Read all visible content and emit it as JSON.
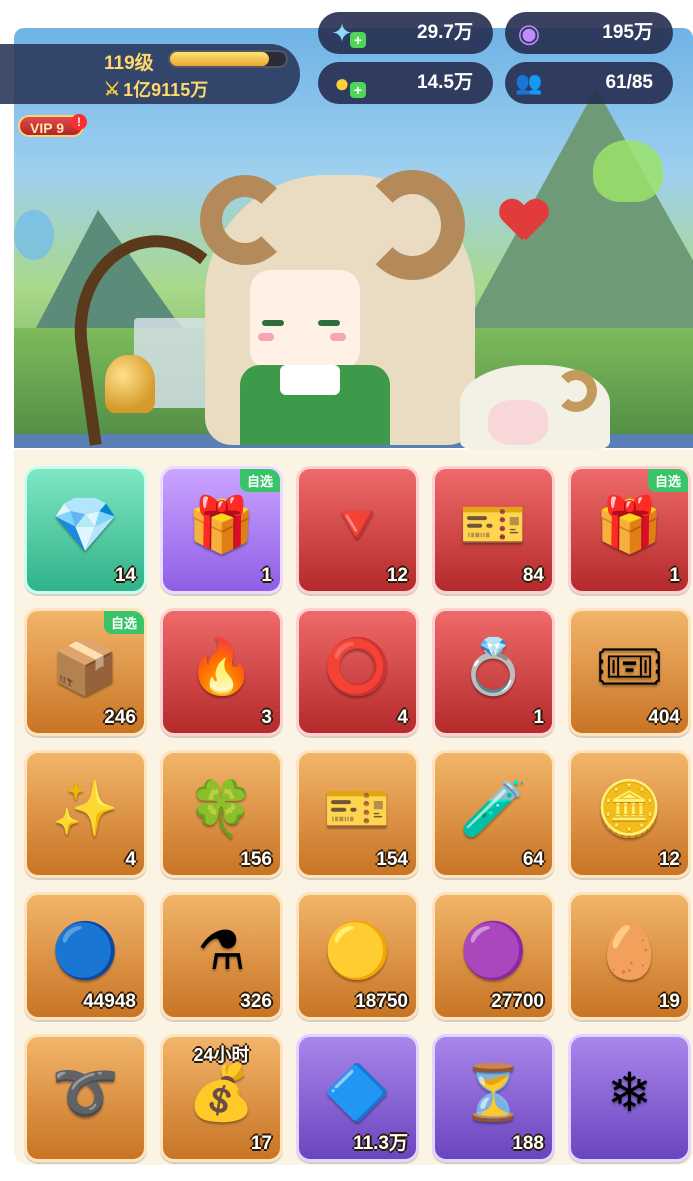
{
  "player": {
    "level": "119级",
    "exp_progress": 0.85,
    "power": "1亿9115万",
    "vip": "VIP 9",
    "vip_alert": "!"
  },
  "currencies": {
    "star": {
      "value": "29.7万",
      "icon": "star-shard-icon"
    },
    "gem": {
      "value": "195万",
      "icon": "purple-gem-icon"
    },
    "coin": {
      "value": "14.5万",
      "icon": "gold-coin-icon"
    },
    "team": {
      "value": "61/85",
      "icon": "team-icon"
    }
  },
  "inventory": [
    {
      "icon": "rainbow-crystal-icon",
      "glyph": "💎",
      "quality": "green",
      "count": "14"
    },
    {
      "icon": "gift-box-selectable-icon",
      "glyph": "🎁",
      "quality": "purple",
      "count": "1",
      "tag": "自选"
    },
    {
      "icon": "red-crystal-icon",
      "glyph": "🔻",
      "quality": "red",
      "count": "12"
    },
    {
      "icon": "gold-ticket-icon",
      "glyph": "🎫",
      "quality": "red",
      "count": "84"
    },
    {
      "icon": "red-gift-box-icon",
      "glyph": "🎁",
      "quality": "red",
      "count": "1",
      "tag": "自选"
    },
    {
      "icon": "treasure-chest-selectable-icon",
      "glyph": "📦",
      "quality": "orange",
      "count": "246",
      "tag": "自选"
    },
    {
      "icon": "fire-egg-icon",
      "glyph": "🔥",
      "quality": "red",
      "count": "3"
    },
    {
      "icon": "silver-ring-icon",
      "glyph": "⭕",
      "quality": "red",
      "count": "4"
    },
    {
      "icon": "feather-ring-icon",
      "glyph": "💍",
      "quality": "red",
      "count": "1"
    },
    {
      "icon": "scroll-ticket-icon",
      "glyph": "🎟",
      "quality": "orange",
      "count": "404"
    },
    {
      "icon": "blue-star-crystal-icon",
      "glyph": "✨",
      "quality": "orange",
      "count": "4"
    },
    {
      "icon": "green-crystal-icon",
      "glyph": "🍀",
      "quality": "orange",
      "count": "156"
    },
    {
      "icon": "blue-ticket-icon",
      "glyph": "🎫",
      "quality": "orange",
      "count": "154"
    },
    {
      "icon": "rainbow-potion-icon",
      "glyph": "🧪",
      "quality": "orange",
      "count": "64"
    },
    {
      "icon": "star-coin-icon",
      "glyph": "🪙",
      "quality": "orange",
      "count": "12"
    },
    {
      "icon": "silver-token-icon",
      "glyph": "🔵",
      "quality": "orange",
      "count": "44948"
    },
    {
      "icon": "lightning-potion-icon",
      "glyph": "⚗",
      "quality": "orange",
      "count": "326"
    },
    {
      "icon": "gold-token-icon",
      "glyph": "🟡",
      "quality": "orange",
      "count": "18750"
    },
    {
      "icon": "purple-token-icon",
      "glyph": "🟣",
      "quality": "orange",
      "count": "27700"
    },
    {
      "icon": "dragon-egg-icon",
      "glyph": "🥚",
      "quality": "orange",
      "count": "19"
    },
    {
      "icon": "bronze-ring-icon",
      "glyph": "➰",
      "quality": "orange",
      "count": ""
    },
    {
      "icon": "gold-chest-icon",
      "glyph": "💰",
      "quality": "orange",
      "count": "17",
      "top_label": "24小时"
    },
    {
      "icon": "diamond-crystal-icon",
      "glyph": "🔷",
      "quality": "violet",
      "count": "11.3万"
    },
    {
      "icon": "hourglass-icon",
      "glyph": "⏳",
      "quality": "violet",
      "count": "188"
    },
    {
      "icon": "ice-crystal-icon",
      "glyph": "❄",
      "quality": "violet",
      "count": ""
    }
  ]
}
